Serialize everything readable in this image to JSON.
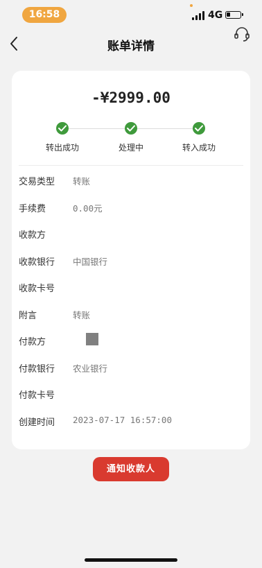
{
  "status_bar": {
    "time": "16:58",
    "network": "4G"
  },
  "header": {
    "title": "账单详情"
  },
  "bill": {
    "amount": "-¥2999.00",
    "steps": [
      {
        "label": "转出成功",
        "status": "done"
      },
      {
        "label": "处理中",
        "status": "done"
      },
      {
        "label": "转入成功",
        "status": "done"
      }
    ],
    "fields": [
      {
        "key": "交易类型",
        "value": "转账"
      },
      {
        "key": "手续费",
        "value": "0.00元"
      },
      {
        "key": "收款方",
        "value": ""
      },
      {
        "key": "收款银行",
        "value": "中国银行"
      },
      {
        "key": "收款卡号",
        "value": ""
      },
      {
        "key": "附言",
        "value": "转账"
      },
      {
        "key": "付款方",
        "value": ""
      },
      {
        "key": "付款银行",
        "value": "农业银行"
      },
      {
        "key": "付款卡号",
        "value": ""
      },
      {
        "key": "创建时间",
        "value": "2023-07-17 16:57:00"
      }
    ]
  },
  "actions": {
    "notify_label": "通知收款人"
  },
  "colors": {
    "accent": "#d93a2f",
    "success": "#3f9a3c",
    "time_pill": "#f0a640"
  },
  "icons": [
    "back-icon",
    "headset-icon",
    "check-icon"
  ]
}
